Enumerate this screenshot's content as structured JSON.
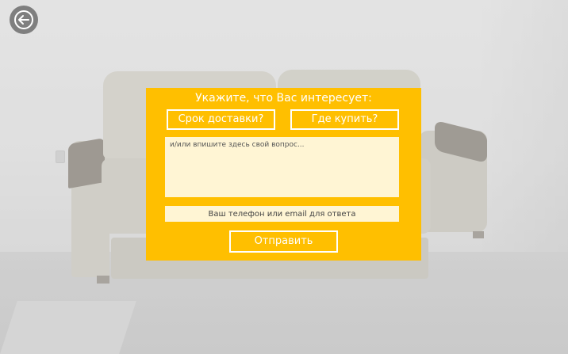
{
  "dialog": {
    "title": "Укажите, что Вас интересует:",
    "options": [
      {
        "label": "Срок доставки?"
      },
      {
        "label": "Где купить?"
      }
    ],
    "question_placeholder": "и/или впишите здесь свой вопрос...",
    "contact_placeholder": "Ваш телефон или email для ответа",
    "submit_label": "Отправить"
  },
  "colors": {
    "dialog_bg": "#ffbf00",
    "field_bg": "#fff5d4",
    "back_button_bg": "#7f7f7f"
  },
  "icons": {
    "back": "arrow-left-circle-icon"
  }
}
